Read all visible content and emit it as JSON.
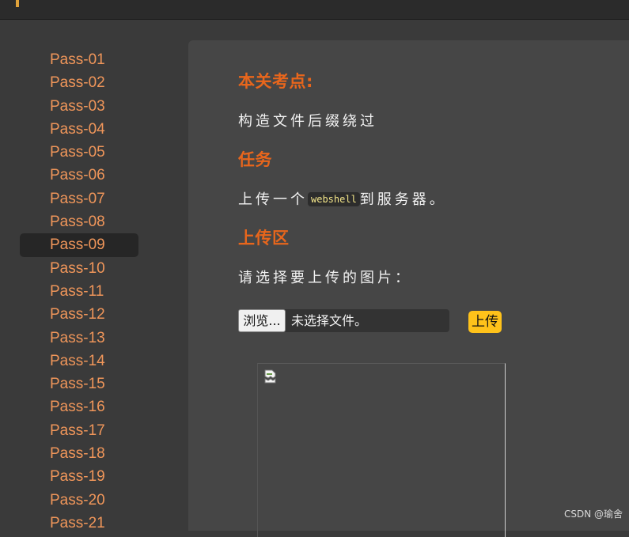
{
  "sidebar": {
    "items": [
      "Pass-01",
      "Pass-02",
      "Pass-03",
      "Pass-04",
      "Pass-05",
      "Pass-06",
      "Pass-07",
      "Pass-08",
      "Pass-09",
      "Pass-10",
      "Pass-11",
      "Pass-12",
      "Pass-13",
      "Pass-14",
      "Pass-15",
      "Pass-16",
      "Pass-17",
      "Pass-18",
      "Pass-19",
      "Pass-20",
      "Pass-21"
    ],
    "active": "Pass-09"
  },
  "main": {
    "heading_point": "本关考点:",
    "point_text": "构造文件后缀绕过",
    "heading_task": "任务",
    "task_prefix": "上传一个",
    "task_code": "webshell",
    "task_suffix": "到服务器。",
    "heading_upload": "上传区",
    "upload_prompt": "请选择要上传的图片：",
    "browse_label": "浏览...",
    "file_status": "未选择文件。",
    "upload_button": "上传"
  },
  "watermark": "CSDN @瑜舍",
  "colors": {
    "sidebar_link": "#f0965a",
    "heading": "#e8661c",
    "upload_button": "#ffc21a",
    "panel_bg": "#464646"
  }
}
